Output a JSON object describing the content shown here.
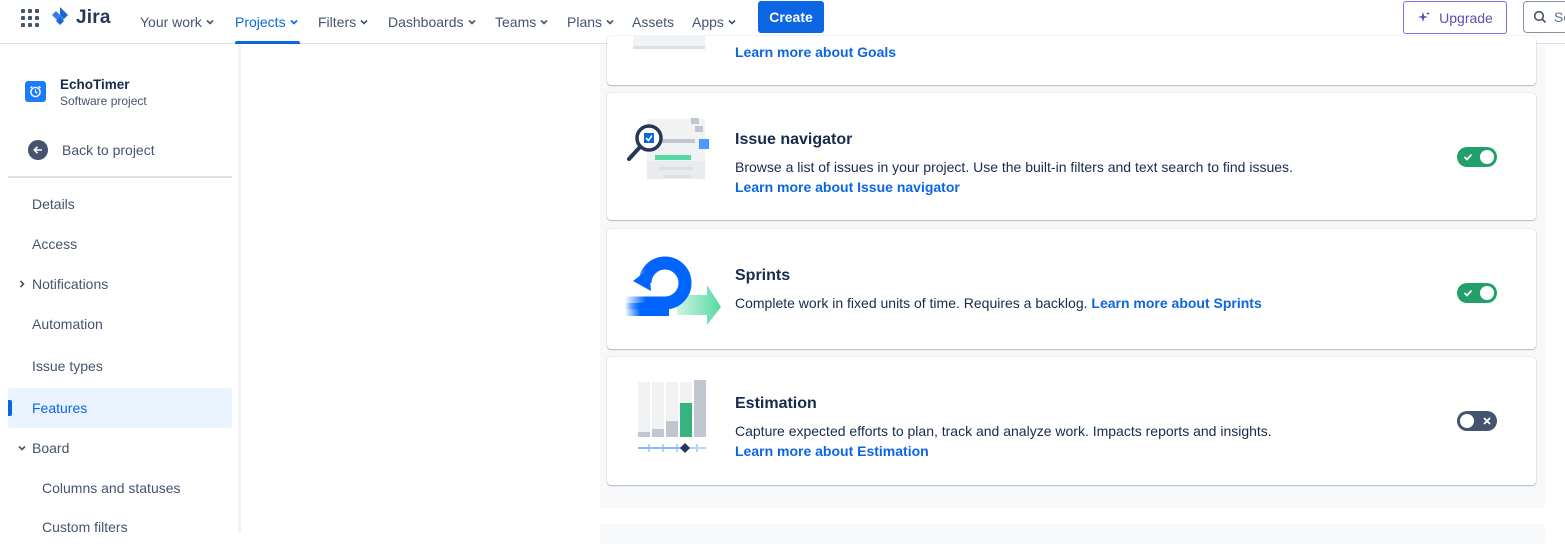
{
  "topnav": {
    "brand": "Jira",
    "items": [
      {
        "label": "Your work",
        "dropdown": true
      },
      {
        "label": "Projects",
        "dropdown": true,
        "active": true
      },
      {
        "label": "Filters",
        "dropdown": true
      },
      {
        "label": "Dashboards",
        "dropdown": true
      },
      {
        "label": "Teams",
        "dropdown": true
      },
      {
        "label": "Plans",
        "dropdown": true
      },
      {
        "label": "Assets",
        "dropdown": false
      },
      {
        "label": "Apps",
        "dropdown": true
      }
    ],
    "create_label": "Create",
    "upgrade_label": "Upgrade",
    "search_placeholder": "Se"
  },
  "sidebar": {
    "project_name": "EchoTimer",
    "project_type": "Software project",
    "back_label": "Back to project",
    "items": [
      {
        "label": "Details"
      },
      {
        "label": "Access"
      },
      {
        "label": "Notifications",
        "expandable": true,
        "expanded": false
      },
      {
        "label": "Automation"
      },
      {
        "label": "Issue types"
      },
      {
        "label": "Features",
        "selected": true
      },
      {
        "label": "Board",
        "expandable": true,
        "expanded": true
      },
      {
        "label": "Columns and statuses",
        "sub": true
      },
      {
        "label": "Custom filters",
        "sub": true
      }
    ]
  },
  "features": {
    "goals": {
      "link": "Learn more about Goals"
    },
    "issue_navigator": {
      "title": "Issue navigator",
      "description": "Browse a list of issues in your project. Use the built-in filters and text search to find issues.",
      "link": "Learn more about Issue navigator",
      "enabled": true
    },
    "sprints": {
      "title": "Sprints",
      "description": "Complete work in fixed units of time. Requires a backlog.",
      "link": "Learn more about Sprints",
      "enabled": true
    },
    "estimation": {
      "title": "Estimation",
      "description": "Capture expected efforts to plan, track and analyze work. Impacts reports and insights.",
      "link": "Learn more about Estimation",
      "enabled": false
    }
  },
  "colors": {
    "primary": "#0c66e4",
    "toggle_on": "#22a06b",
    "toggle_off": "#44546f",
    "upgrade": "#5e4db2"
  },
  "icons": [
    "app-switcher-icon",
    "jira-logo-icon",
    "chevron-down-icon",
    "sparkle-icon",
    "search-icon",
    "project-timer-icon",
    "arrow-left-icon",
    "chevron-right-icon",
    "check-icon",
    "cross-icon"
  ]
}
